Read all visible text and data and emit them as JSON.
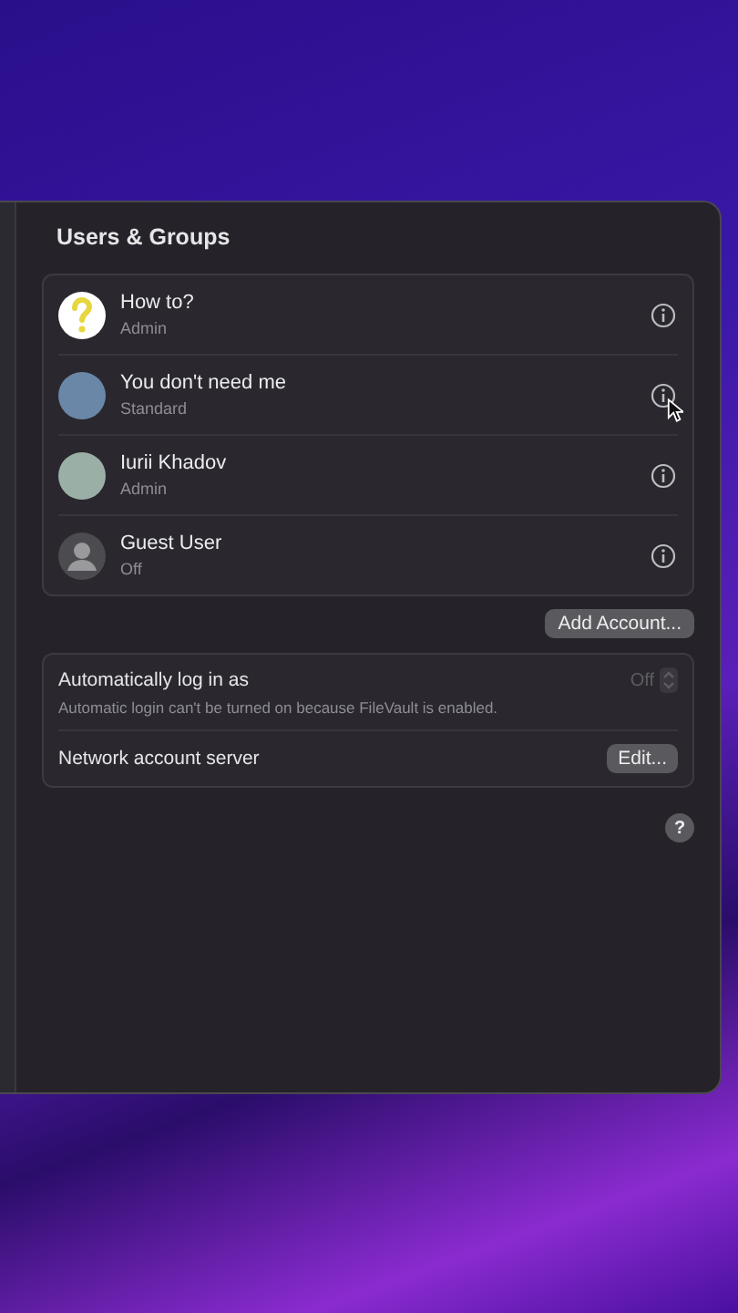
{
  "window": {
    "title": "Users & Groups"
  },
  "users": [
    {
      "name": "How to?",
      "role": "Admin",
      "kind": "question"
    },
    {
      "name": "You don't need me",
      "role": "Standard",
      "kind": "photo"
    },
    {
      "name": "Iurii Khadov",
      "role": "Admin",
      "kind": "photo"
    },
    {
      "name": "Guest User",
      "role": "Off",
      "kind": "guest"
    }
  ],
  "add_account_button": "Add Account...",
  "settings": [
    {
      "kind": "popup",
      "label": "Automatically log in as",
      "note": "Automatic login can't be turned on because FileVault is enabled.",
      "value": "Off",
      "disabled": true
    },
    {
      "kind": "button",
      "label": "Network account server",
      "button": "Edit..."
    }
  ],
  "help_button": "?"
}
